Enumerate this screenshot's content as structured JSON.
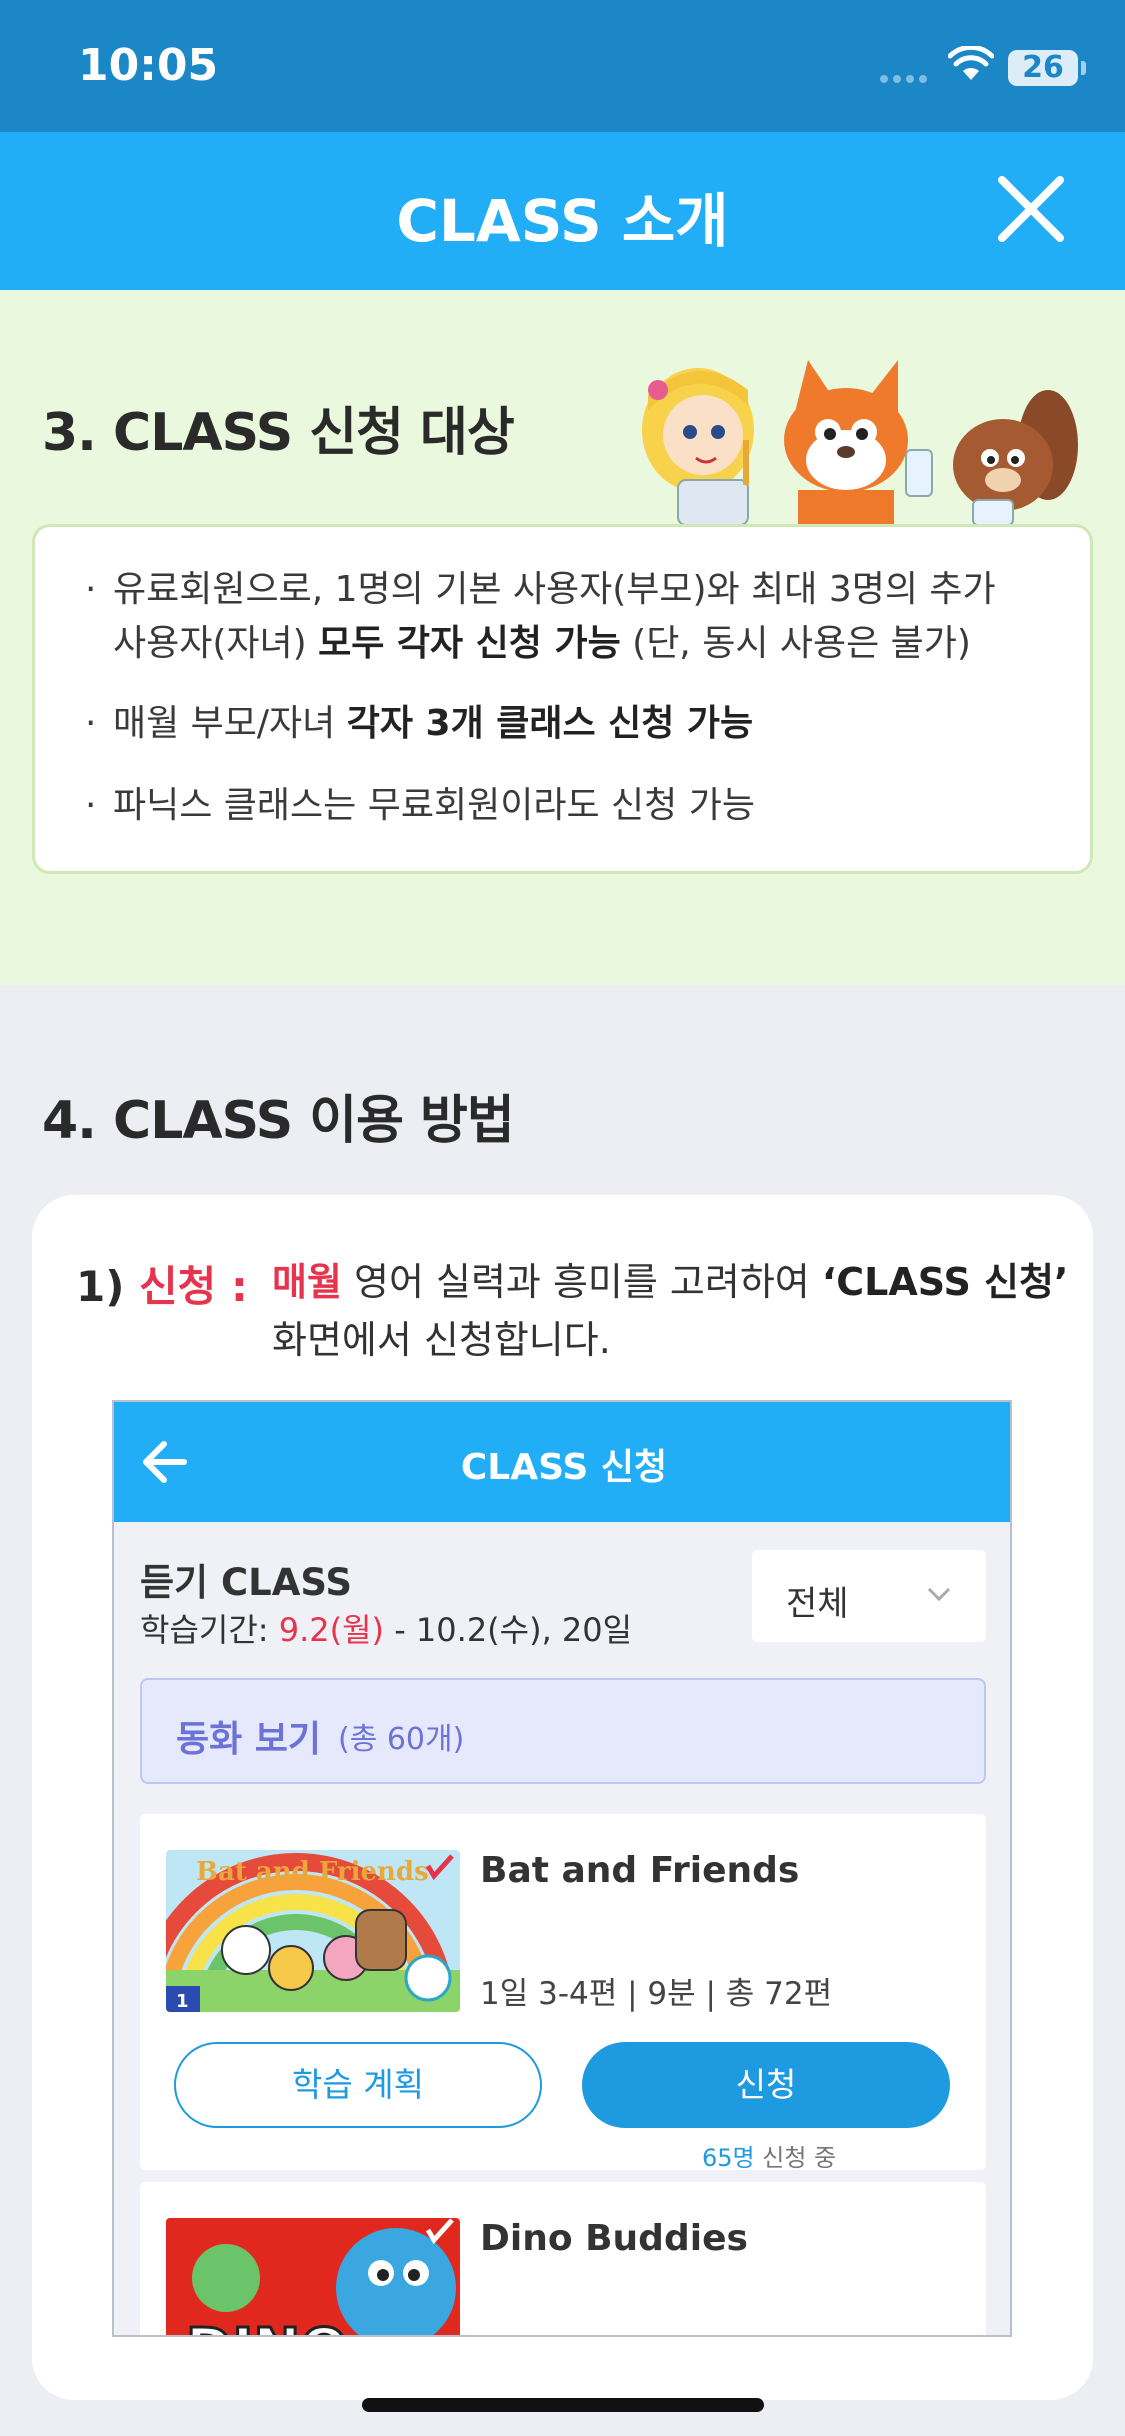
{
  "status_bar": {
    "time": "10:05",
    "battery": "26"
  },
  "header": {
    "title": "CLASS 소개"
  },
  "section3": {
    "title": "3. CLASS 신청 대상",
    "bullets": [
      {
        "lines": [
          [
            {
              "t": "유료회원으로, 1명의 기본 사용자(부모)와 최대 3명의 추가",
              "b": false
            }
          ],
          [
            {
              "t": "사용자(자녀) ",
              "b": false
            },
            {
              "t": "모두 각자 신청 가능",
              "b": true
            },
            {
              "t": " (단, 동시 사용은 불가)",
              "b": false
            }
          ]
        ]
      },
      {
        "lines": [
          [
            {
              "t": "매월 부모/자녀 ",
              "b": false
            },
            {
              "t": "각자 3개 클래스 신청 가능",
              "b": true
            }
          ]
        ]
      },
      {
        "lines": [
          [
            {
              "t": "파닉스 클래스는 무료회원이라도 신청 가능",
              "b": false
            }
          ]
        ]
      }
    ]
  },
  "section4": {
    "title": "4. CLASS 이용 방법",
    "step": {
      "number": "1)",
      "label": "신청 :",
      "desc_line1_red": "매월",
      "desc_line1_rest": " 영어 실력과 흥미를 고려하여 ",
      "desc_line1_bold": "‘CLASS 신청’",
      "desc_line2": "화면에서 신청합니다."
    },
    "mock": {
      "title": "CLASS 신청",
      "class_name": "듣기 CLASS",
      "period_prefix": "학습기간: ",
      "period_red": "9.2(월)",
      "period_rest": " - 10.2(수), 20일",
      "dropdown": "전체",
      "category_title": "동화 보기",
      "category_count": "(총 60개)",
      "items": [
        {
          "name": "Bat and Friends",
          "meta": "1일 3-4편 | 9분 | 총 72편",
          "thumb_title": "Bat and Friends",
          "badge": "1",
          "plan": "학습 계획",
          "apply": "신청",
          "applying_count": "65명",
          "applying_text": " 신청 중"
        },
        {
          "name": "Dino Buddies",
          "thumb_title": "DINO"
        }
      ]
    }
  }
}
